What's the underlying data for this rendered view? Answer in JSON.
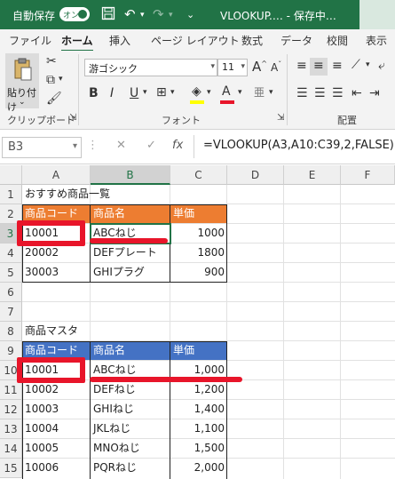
{
  "titlebar": {
    "autosave_label": "自動保存",
    "autosave_state": "オン",
    "doc_title": "VLOOKUP.… - 保存中…",
    "icons": [
      "save-icon",
      "undo-icon",
      "redo-icon"
    ]
  },
  "tabs": [
    "ファイル",
    "ホーム",
    "挿入",
    "ページ レイアウト",
    "数式",
    "データ",
    "校閲",
    "表示"
  ],
  "active_tab": "ホーム",
  "ribbon": {
    "paste_label": "貼り付け",
    "clipboard_group": "クリップボード",
    "font_name": "游ゴシック",
    "font_size": "11",
    "font_group": "フォント",
    "align_group": "配置",
    "bold": "B",
    "italic": "I",
    "underline": "U",
    "grow": "A",
    "shrink": "A"
  },
  "formula_bar": {
    "name_box": "B3",
    "cancel": "✕",
    "enter": "✓",
    "fx": "fx",
    "formula": "=VLOOKUP(A3,A10:C39,2,FALSE)"
  },
  "columns": [
    "A",
    "B",
    "C",
    "D",
    "E",
    "F"
  ],
  "rows": [
    "1",
    "2",
    "3",
    "4",
    "5",
    "6",
    "7",
    "8",
    "9",
    "10",
    "11",
    "12",
    "13",
    "14",
    "15"
  ],
  "sheet": {
    "a1": "おすすめ商品一覧",
    "table1_headers": [
      "商品コード",
      "商品名",
      "単価"
    ],
    "table1_rows": [
      [
        "10001",
        "ABCねじ",
        "1000"
      ],
      [
        "20002",
        "DEFプレート",
        "1800"
      ],
      [
        "30003",
        "GHIプラグ",
        "900"
      ]
    ],
    "a8": "商品マスタ",
    "table2_headers": [
      "商品コード",
      "商品名",
      "単価"
    ],
    "table2_rows": [
      [
        "10001",
        "ABCねじ",
        "1,000"
      ],
      [
        "10002",
        "DEFねじ",
        "1,200"
      ],
      [
        "10003",
        "GHIねじ",
        "1,400"
      ],
      [
        "10004",
        "JKLねじ",
        "1,100"
      ],
      [
        "10005",
        "MNOねじ",
        "1,500"
      ],
      [
        "10006",
        "PQRねじ",
        "2,000"
      ]
    ]
  },
  "colors": {
    "excel_green": "#217346",
    "orange_header": "#ed7d31",
    "blue_header": "#4472c4",
    "annotation_red": "#e8152a"
  }
}
